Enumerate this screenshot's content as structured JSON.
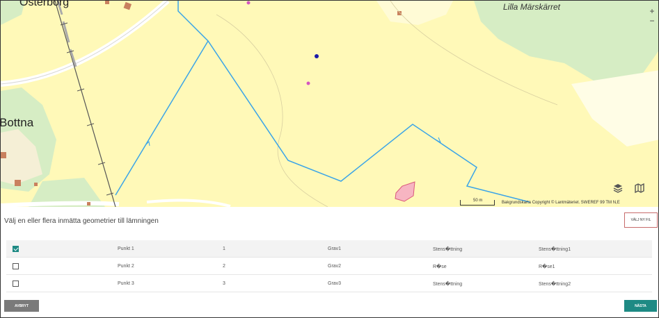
{
  "map": {
    "labels": {
      "osterborg": "Österborg",
      "bottna": "Bottna",
      "lilla": "Lilla Märskärret"
    },
    "zoom_in": "+",
    "zoom_out": "−",
    "scale": "50 m",
    "attribution": "Bakgrundskarta Copyright © Lantmäteriet. SWEREF 99 TM N,E",
    "colors": {
      "background": "#fff9b8",
      "green": "#d6edc4",
      "road": "#ffffff",
      "line": "#3aa4e8",
      "polygon": "#f7b5c2"
    }
  },
  "instruction": "Välj en eller flera inmätta geometrier till lämningen",
  "choose_file": "VÄLJ NY FIL",
  "rows": [
    {
      "checked": true,
      "col1": "Punkt 1",
      "col2": "1",
      "col3": "Grav1",
      "col4": "Stens�ttning",
      "col5": "Stens�ttning1"
    },
    {
      "checked": false,
      "col1": "Punkt 2",
      "col2": "2",
      "col3": "Grav2",
      "col4": "R�se",
      "col5": "R�se1"
    },
    {
      "checked": false,
      "col1": "Punkt 3",
      "col2": "3",
      "col3": "Grav3",
      "col4": "Stens�ttning",
      "col5": "Stens�ttning2"
    }
  ],
  "buttons": {
    "cancel": "AVBRYT",
    "next": "NÄSTA"
  }
}
